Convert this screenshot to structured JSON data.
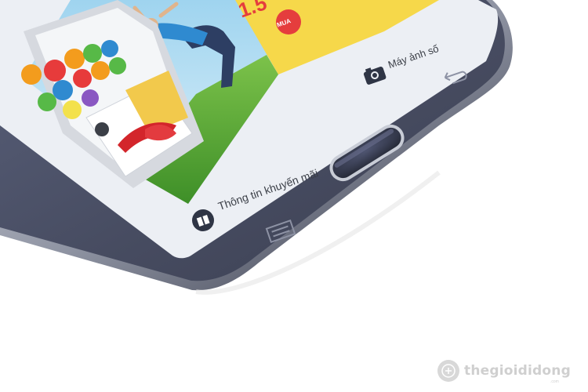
{
  "screen": {
    "promo_label": "Thông tin khuyến mãi",
    "camera_label": "Máy ảnh số",
    "price_fragment": "1.5",
    "buy_badge": "MUA"
  },
  "icons": {
    "gift": "gift-icon",
    "camera": "camera-icon",
    "back": "back-arrow-icon",
    "menu": "menu-icon",
    "home": "home-button"
  },
  "watermark": {
    "brand": "thegioididong",
    "domain": ".com"
  },
  "colors": {
    "phone_body": "#4a4f63",
    "screen_bg": "#e9ecf1",
    "chrome_rim": "#b8bcc6"
  }
}
